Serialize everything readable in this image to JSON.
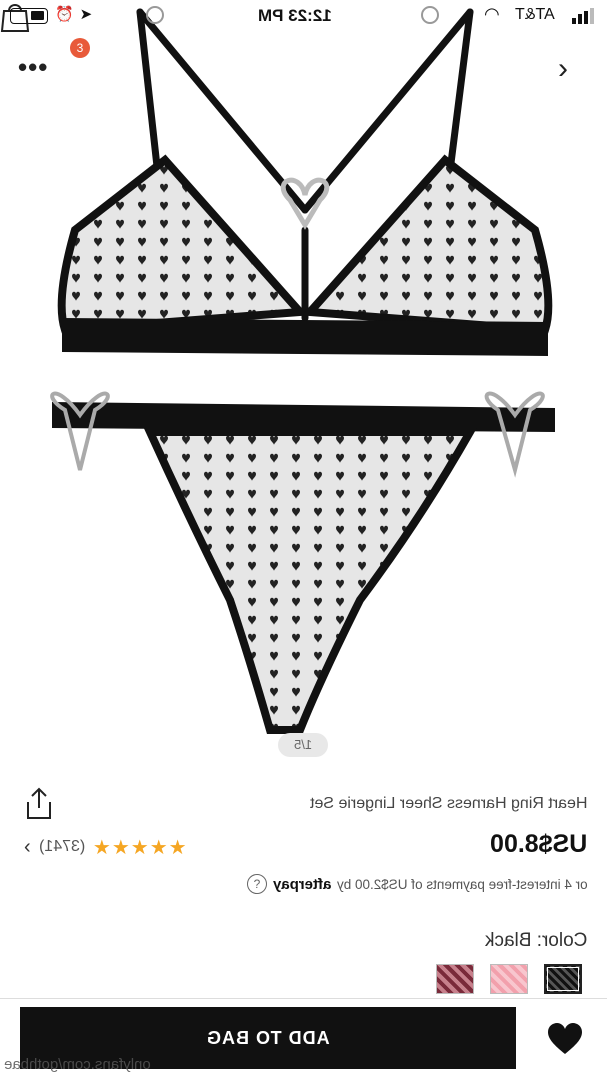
{
  "status_bar": {
    "time": "12:23 PM",
    "carrier": "AT&T"
  },
  "header": {
    "cart_count": "3",
    "more_icon": "more-dots-icon",
    "bag_icon": "shopping-bag-icon",
    "next_icon": "chevron-right-icon"
  },
  "gallery": {
    "pager": "1/5"
  },
  "product": {
    "title": "Heart Ring Harness Sheer Lingerie Set",
    "price": "US$8.00",
    "rating_stars": 4.5,
    "review_count": "(3741)",
    "installment_text": "or 4 interest-free payments of US$2.00 by",
    "afterpay_logo": "afterpay",
    "help_symbol": "?",
    "color_label": "Color: Black",
    "swatches": [
      "burgundy-heart-mesh",
      "pink-heart-mesh",
      "black-heart-mesh"
    ],
    "selected_swatch": "black-heart-mesh"
  },
  "actions": {
    "add_to_bag": "ADD TO BAG",
    "wishlist_icon": "heart-icon"
  },
  "watermark": "onlyfans.com/gothbae",
  "colors": {
    "button_bg": "#111111",
    "star": "#f5a623",
    "badge": "#e85a3a"
  }
}
